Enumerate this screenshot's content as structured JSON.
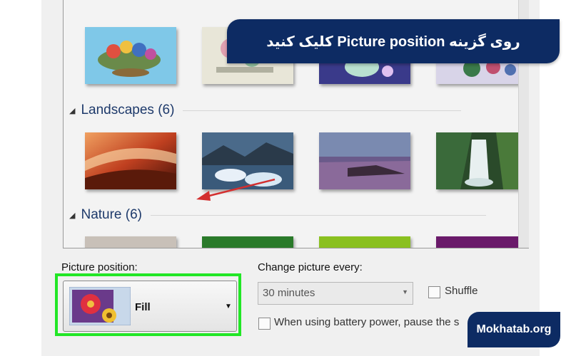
{
  "banner": {
    "text": "روی گزینه Picture position کلیک کنید"
  },
  "watermark": {
    "text": "Mokhatab.org"
  },
  "gallery": {
    "groups": [
      {
        "name": "Landscapes (6)"
      },
      {
        "name": "Nature (6)"
      }
    ]
  },
  "picture_position": {
    "label": "Picture position:",
    "value": "Fill"
  },
  "change_picture": {
    "label": "Change picture every:",
    "value": "30 minutes"
  },
  "shuffle": {
    "label": "Shuffle",
    "checked": false
  },
  "battery": {
    "label": "When using battery power, pause the s",
    "checked": false
  },
  "colors": {
    "highlight": "#22e626",
    "banner_bg": "#0d2b63",
    "arrow": "#d32f2f",
    "group_header": "#1e3a6b"
  }
}
